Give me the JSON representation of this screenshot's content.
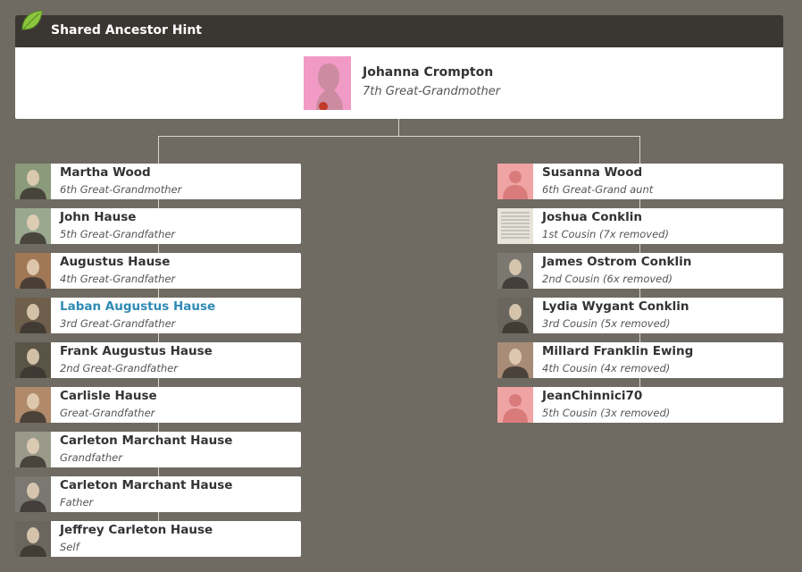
{
  "header": {
    "title": "Shared Ancestor Hint",
    "icon": "leaf-icon"
  },
  "ancestor": {
    "name": "Johanna Crompton",
    "relation": "7th Great-Grandmother"
  },
  "left_line": [
    {
      "name": "Martha Wood",
      "relation": "6th Great-Grandmother",
      "photo": "photo"
    },
    {
      "name": "John Hause",
      "relation": "5th Great-Grandfather",
      "photo": "photo"
    },
    {
      "name": "Augustus Hause",
      "relation": "4th Great-Grandfather",
      "photo": "photo"
    },
    {
      "name": "Laban Augustus Hause",
      "relation": "3rd Great-Grandfather",
      "photo": "photo",
      "link": true
    },
    {
      "name": "Frank Augustus Hause",
      "relation": "2nd Great-Grandfather",
      "photo": "photo"
    },
    {
      "name": "Carlisle Hause",
      "relation": "Great-Grandfather",
      "photo": "photo"
    },
    {
      "name": "Carleton Marchant Hause",
      "relation": "Grandfather",
      "photo": "photo"
    },
    {
      "name": "Carleton Marchant Hause",
      "relation": "Father",
      "photo": "photo"
    },
    {
      "name": "Jeffrey Carleton Hause",
      "relation": "Self",
      "photo": "photo"
    }
  ],
  "right_line": [
    {
      "name": "Susanna Wood",
      "relation": "6th Great-Grand aunt",
      "photo": "silhouette"
    },
    {
      "name": "Joshua Conklin",
      "relation": "1st Cousin (7x removed)",
      "photo": "document"
    },
    {
      "name": "James Ostrom Conklin",
      "relation": "2nd Cousin (6x removed)",
      "photo": "photo"
    },
    {
      "name": "Lydia Wygant Conklin",
      "relation": "3rd Cousin (5x removed)",
      "photo": "photo"
    },
    {
      "name": "Millard Franklin Ewing",
      "relation": "4th Cousin (4x removed)",
      "photo": "photo"
    },
    {
      "name": "JeanChinnici70",
      "relation": "5th Cousin (3x removed)",
      "photo": "silhouette"
    }
  ],
  "colors": {
    "link": "#2f8ab5",
    "header_bg": "#3a3733",
    "page_bg": "#6f6a62",
    "silhouette_bg": "#f0a3a3"
  }
}
